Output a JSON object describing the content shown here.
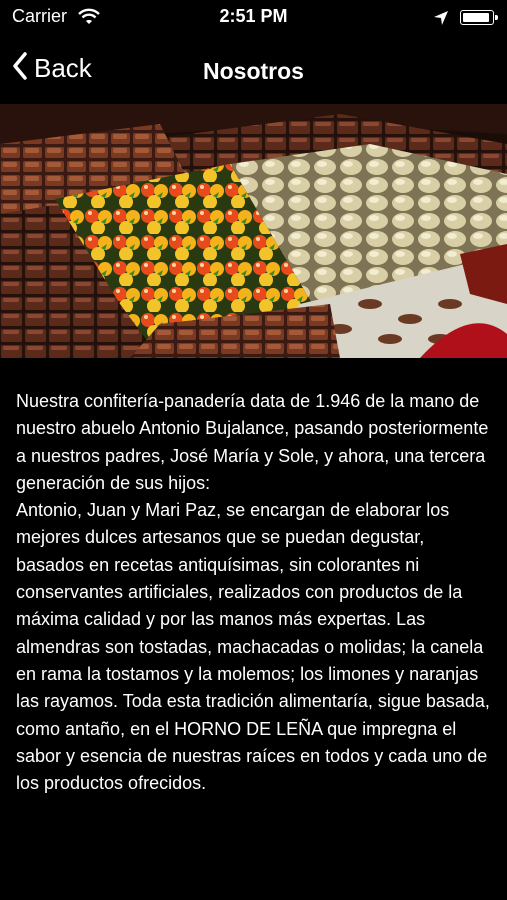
{
  "status_bar": {
    "carrier": "Carrier",
    "time": "2:51 PM",
    "battery_level": 1.0
  },
  "nav": {
    "back_label": "Back",
    "title": "Nosotros"
  },
  "hero_image": {
    "alt": "pastries-display"
  },
  "body": {
    "text": "Nuestra confitería-panadería data de 1.946 de la mano de nuestro abuelo Antonio Bujalance, pasando posteriormente a nuestros padres, José María y Sole, y ahora, una tercera generación de sus hijos:\nAntonio, Juan y Mari Paz, se encargan de elaborar los mejores dulces artesanos que se puedan degustar, basados en recetas antiquísimas, sin colorantes ni conservantes artificiales, realizados con productos de la máxima calidad y por las manos más expertas. Las almendras son tostadas, machacadas o molidas; la canela en rama la tostamos y la molemos; los limones y naranjas las rayamos. Toda esta tradición alimentaría, sigue basada, como antaño, en el HORNO DE LEÑA que impregna el sabor y esencia de nuestras raíces en todos y cada uno de los productos ofrecidos."
  },
  "colors": {
    "background": "#000000",
    "text": "#ffffff"
  }
}
